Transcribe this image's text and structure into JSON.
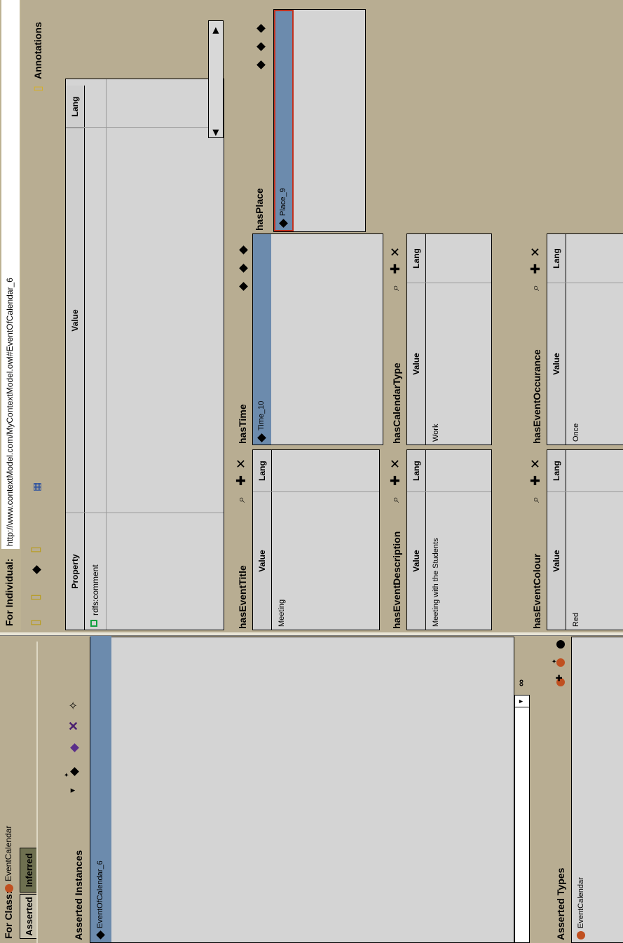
{
  "class_bar": {
    "label": "For Class:",
    "class_name": "EventCalendar"
  },
  "tabs": [
    {
      "label": "Asserted"
    },
    {
      "label": "Inferred"
    }
  ],
  "asserted_instances": {
    "title": "Asserted Instances",
    "items": [
      "EventOfCalendar_6"
    ]
  },
  "asserted_types": {
    "title": "Asserted Types",
    "items": [
      "EventCalendar"
    ]
  },
  "individual_bar": {
    "label": "For Individual:",
    "uri": "http://www.contextModel.com/MyContextModel.owl#EventOfCalendar_6"
  },
  "annotations": {
    "label": "Annotations",
    "columns": {
      "property": "Property",
      "value": "Value",
      "lang": "Lang"
    },
    "rows": [
      {
        "property": "rdfs:comment",
        "value": "",
        "lang": ""
      }
    ]
  },
  "props": {
    "title": {
      "name": "hasEventTitle",
      "col_value": "Value",
      "col_lang": "Lang",
      "value": "Meeting"
    },
    "description": {
      "name": "hasEventDescription",
      "col_value": "Value",
      "col_lang": "Lang",
      "value": "Meeting with the Students"
    },
    "colour": {
      "name": "hasEventColour",
      "col_value": "Value",
      "col_lang": "Lang",
      "value": "Red"
    },
    "time": {
      "name": "hasTime",
      "item": "Time_10"
    },
    "calendar_type": {
      "name": "hasCalendarType",
      "col_value": "Value",
      "col_lang": "Lang",
      "value": "Work"
    },
    "occurance": {
      "name": "hasEventOccurance",
      "col_value": "Value",
      "col_lang": "Lang",
      "value": "Once"
    },
    "place": {
      "name": "hasPlace",
      "item": "Place_9"
    }
  },
  "icons": {
    "search": "⌕",
    "add": "✚",
    "remove": "✕",
    "class_color": "#c05020",
    "selection_color": "#6c8bad"
  }
}
